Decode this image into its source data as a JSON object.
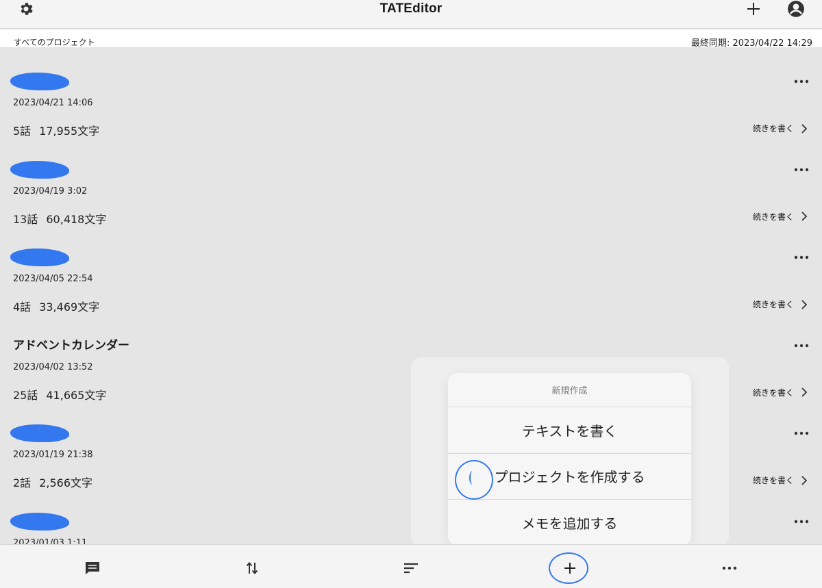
{
  "app": {
    "title": "TATEditor"
  },
  "subheader": {
    "scope": "すべてのプロジェクト",
    "last_sync": "最終同期: 2023/04/22 14:29"
  },
  "projects": [
    {
      "name": "",
      "redacted": true,
      "date": "2023/04/21 14:06",
      "episodes": "5話",
      "chars": "17,955文字",
      "continue_label": "続きを書く"
    },
    {
      "name": "",
      "redacted": true,
      "date": "2023/04/19 3:02",
      "episodes": "13話",
      "chars": "60,418文字",
      "continue_label": "続きを書く"
    },
    {
      "name": "",
      "redacted": true,
      "date": "2023/04/05 22:54",
      "episodes": "4話",
      "chars": "33,469文字",
      "continue_label": "続きを書く"
    },
    {
      "name": "アドベントカレンダー",
      "redacted": false,
      "date": "2023/04/02 13:52",
      "episodes": "25話",
      "chars": "41,665文字",
      "continue_label": "続きを書く"
    },
    {
      "name": "",
      "redacted": true,
      "date": "2023/01/19 21:38",
      "episodes": "2話",
      "chars": "2,566文字",
      "continue_label": "続きを書く"
    },
    {
      "name": "",
      "redacted": true,
      "date": "2023/01/03 1:11",
      "episodes": "",
      "chars": "",
      "continue_label": ""
    }
  ],
  "popover": {
    "title": "新規作成",
    "items": [
      "テキストを書く",
      "プロジェクトを作成する",
      "メモを追加する"
    ]
  },
  "icons": {
    "settings": "gear-icon",
    "add": "plus-icon",
    "account": "account-circle-icon",
    "more": "ellipsis-icon",
    "continue": "chevron-right-icon",
    "comment": "comment-icon",
    "sort": "sort-arrows-icon",
    "filter": "filter-lines-icon"
  },
  "colors": {
    "annotation": "#3478f0",
    "background": "#e5e5e5",
    "bar": "#f4f4f4"
  }
}
